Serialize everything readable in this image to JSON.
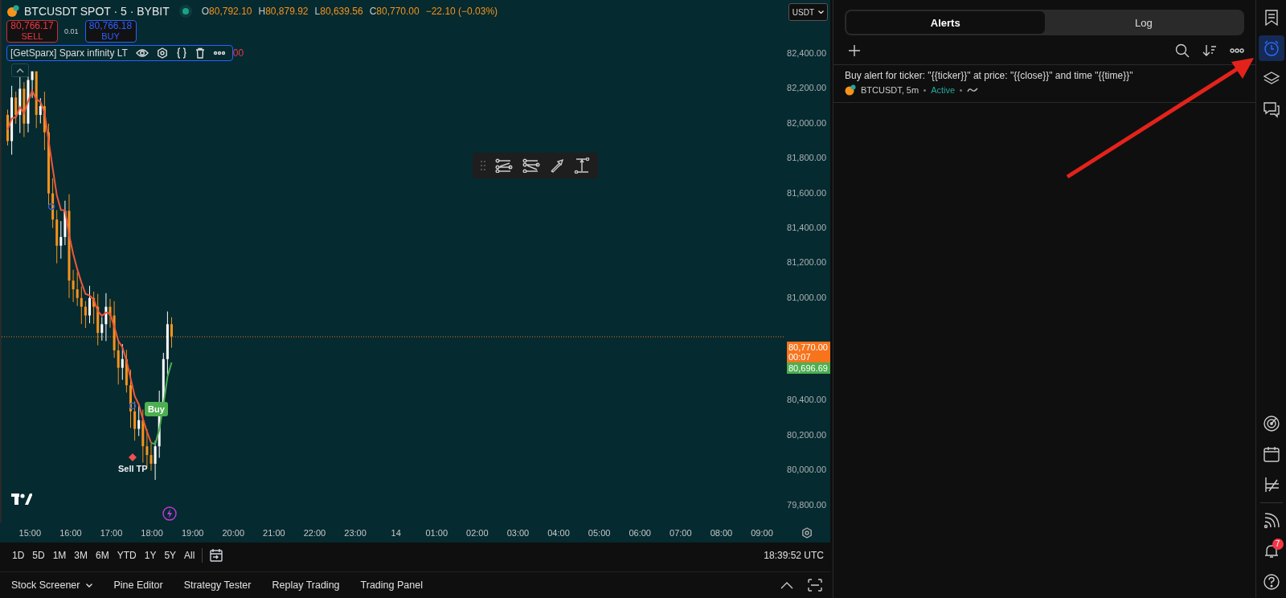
{
  "chart": {
    "symbol": "BTCUSDT SPOT · 5 · BYBIT",
    "ohlc": [
      {
        "label": "O",
        "value": "80,792.10"
      },
      {
        "label": "H",
        "value": "80,879.92"
      },
      {
        "label": "L",
        "value": "80,639.56"
      },
      {
        "label": "C",
        "value": "80,770.00"
      }
    ],
    "change": "−22.10 (−0.03%)",
    "sell": {
      "price": "80,766.17",
      "label": "SELL"
    },
    "spread": "0.01",
    "buy": {
      "price": "80,766.18",
      "label": "BUY"
    },
    "indicator": {
      "name": "[GetSparx] Sparx infinity LT",
      "value_tail": "00"
    },
    "currency": "USDT",
    "price_axis": [
      {
        "kind": "tick",
        "text": "82,400.00"
      },
      {
        "kind": "tick",
        "text": "82,200.00"
      },
      {
        "kind": "tick",
        "text": "82,000.00"
      },
      {
        "kind": "tick",
        "text": "81,800.00"
      },
      {
        "kind": "tick",
        "text": "81,600.00"
      },
      {
        "kind": "tick",
        "text": "81,400.00"
      },
      {
        "kind": "tick",
        "text": "81,200.00"
      },
      {
        "kind": "tick",
        "text": "81,000.00"
      },
      {
        "kind": "markers",
        "items": [
          {
            "price": "80,770.00",
            "countdown": "00:07",
            "color": "#f7731c"
          },
          {
            "price": "80,696.69",
            "color": "#4caf50"
          }
        ]
      },
      {
        "kind": "tick",
        "text": "80,400.00"
      },
      {
        "kind": "tick",
        "text": "80,200.00"
      },
      {
        "kind": "tick",
        "text": "80,000.00"
      },
      {
        "kind": "tick",
        "text": "79,800.00"
      }
    ],
    "time_axis": [
      "15:00",
      "16:00",
      "17:00",
      "18:00",
      "19:00",
      "20:00",
      "21:00",
      "22:00",
      "23:00",
      "14",
      "01:00",
      "02:00",
      "03:00",
      "04:00",
      "05:00",
      "06:00",
      "07:00",
      "08:00",
      "09:00"
    ],
    "signals": [
      {
        "kind": "buy",
        "text": "Buy"
      },
      {
        "kind": "sell-tp",
        "text": "Sell TP"
      }
    ]
  },
  "range_bar": {
    "ranges": [
      "1D",
      "5D",
      "1M",
      "3M",
      "6M",
      "YTD",
      "1Y",
      "5Y",
      "All"
    ],
    "clock": "18:39:52 UTC"
  },
  "bottom_tabs": [
    {
      "label": "Stock Screener",
      "kind": "menu"
    },
    {
      "label": "Pine Editor",
      "kind": "plain"
    },
    {
      "label": "Strategy Tester",
      "kind": "plain"
    },
    {
      "label": "Replay Trading",
      "kind": "plain"
    },
    {
      "label": "Trading Panel",
      "kind": "plain"
    }
  ],
  "alerts_panel": {
    "tabs": [
      {
        "label": "Alerts",
        "selected": true
      },
      {
        "label": "Log",
        "selected": false
      }
    ],
    "alerts": [
      {
        "title": "Buy alert for ticker: \"{{ticker}}\" at price: \"{{close}}\" and time \"{{time}}\"",
        "symbol": "BTCUSDT, 5m",
        "status": "Active"
      }
    ]
  },
  "right_toolbar": {
    "top": [
      {
        "kind": "watchlist",
        "selected": false
      },
      {
        "kind": "alerts",
        "selected": true
      },
      {
        "kind": "layers",
        "selected": false
      },
      {
        "kind": "chat",
        "selected": false
      }
    ],
    "bottom": [
      {
        "kind": "radar",
        "selected": false
      },
      {
        "kind": "calendar",
        "selected": false
      },
      {
        "kind": "lines",
        "selected": false
      },
      {
        "kind": "divider"
      },
      {
        "kind": "signal",
        "selected": false
      },
      {
        "kind": "bell",
        "selected": false,
        "badge": "7"
      },
      {
        "kind": "help",
        "selected": false
      }
    ]
  }
}
